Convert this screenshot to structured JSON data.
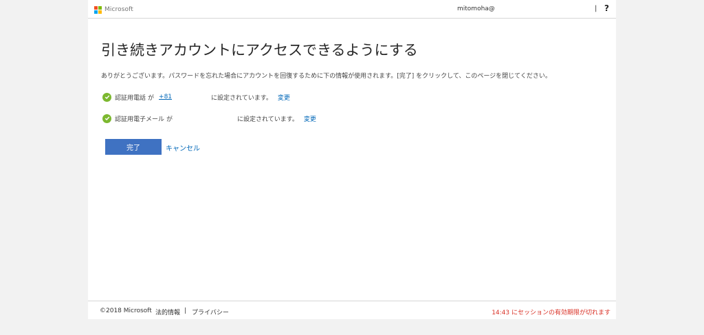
{
  "header": {
    "brand": "Microsoft",
    "user": "mitomoha@",
    "separator": "|",
    "help": "?"
  },
  "main": {
    "title": "引き続きアカウントにアクセスできるようにする",
    "description": "ありがとうございます。パスワードを忘れた場合にアカウントを回復するために下の情報が使用されます。[完了] をクリックして、このページを閉じてください。",
    "phone_row": {
      "label": "認証用電話",
      "particle": "が",
      "value": "+81",
      "status": "に設定されています。",
      "change": "変更"
    },
    "email_row": {
      "label": "認証用電子メール",
      "particle": "が",
      "status": "に設定されています。",
      "change": "変更"
    },
    "done_label": "完了",
    "cancel_label": "キャンセル"
  },
  "footer": {
    "copyright": "©2018 Microsoft",
    "legal": "法的情報",
    "separator": "|",
    "privacy": "プライバシー",
    "session": "14:43 にセッションの有効期限が切れます"
  },
  "colors": {
    "accent": "#3f72c2",
    "link": "#0067b8",
    "check": "#7cb82f",
    "warning": "#d93025",
    "logo": [
      "#f25022",
      "#7fba00",
      "#00a4ef",
      "#ffb900"
    ]
  },
  "icons": [
    "microsoft-logo",
    "check-circle-icon",
    "help-icon"
  ]
}
